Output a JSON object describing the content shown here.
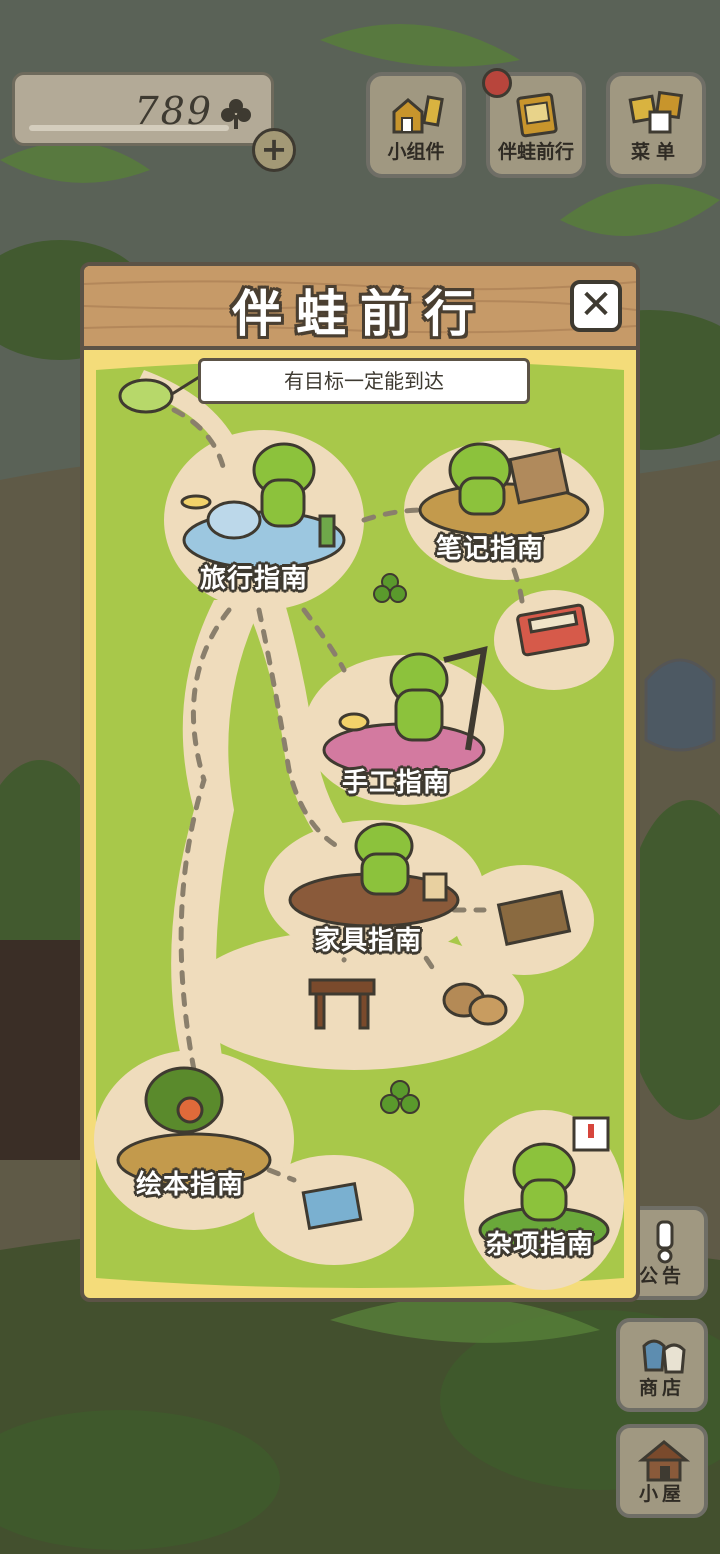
{
  "currency": {
    "amount": "789",
    "icon": "clover-icon",
    "add_icon": "plus-icon"
  },
  "top_buttons": [
    {
      "label": "小组件",
      "icon": "widget-icon"
    },
    {
      "label": "伴蛙前行",
      "icon": "guidebook-icon",
      "badge": true
    },
    {
      "label": "菜单",
      "icon": "menu-cards-icon"
    }
  ],
  "side_buttons": [
    {
      "label": "公告",
      "icon": "exclamation-icon"
    },
    {
      "label": "商店",
      "icon": "shop-bags-icon"
    },
    {
      "label": "小屋",
      "icon": "house-icon"
    }
  ],
  "modal": {
    "title": "伴蛙前行",
    "close_icon": "close-icon",
    "banner": "有目标一定能到达",
    "guides": [
      {
        "label": "旅行指南"
      },
      {
        "label": "笔记指南"
      },
      {
        "label": "手工指南"
      },
      {
        "label": "家具指南"
      },
      {
        "label": "绘本指南"
      },
      {
        "label": "杂项指南"
      }
    ]
  },
  "colors": {
    "accent_wood": "#c69a68",
    "map_green": "#a8c84a",
    "path_beige": "#efdcbc",
    "frame_yellow": "#f4dc7a",
    "outline": "#3f3a30"
  }
}
